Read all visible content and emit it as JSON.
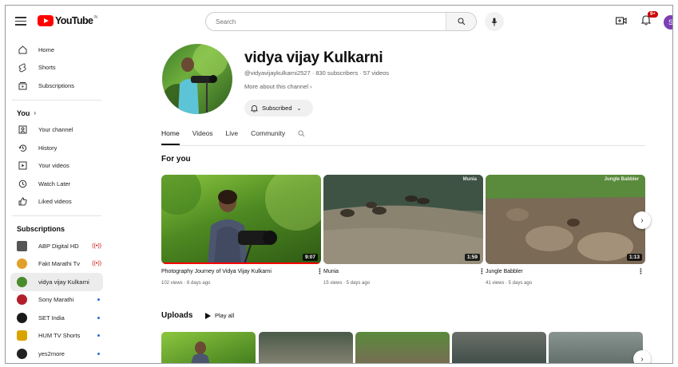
{
  "app": {
    "logo_text": "YouTube",
    "logo_suffix": "IN"
  },
  "search": {
    "placeholder": "Search"
  },
  "notifications": {
    "badge": "9+"
  },
  "account": {
    "initial": "S"
  },
  "sidebar": {
    "main": [
      {
        "label": "Home",
        "icon": "home-icon"
      },
      {
        "label": "Shorts",
        "icon": "shorts-icon"
      },
      {
        "label": "Subscriptions",
        "icon": "subscriptions-icon"
      }
    ],
    "you_title": "You",
    "you": [
      {
        "label": "Your channel",
        "icon": "channel-icon"
      },
      {
        "label": "History",
        "icon": "history-icon"
      },
      {
        "label": "Your videos",
        "icon": "your-videos-icon"
      },
      {
        "label": "Watch Later",
        "icon": "watch-later-icon"
      },
      {
        "label": "Liked videos",
        "icon": "like-icon"
      }
    ],
    "subscriptions_title": "Subscriptions",
    "subscriptions": [
      {
        "label": "ABP Digital HD",
        "color": "#555555",
        "status": "live"
      },
      {
        "label": "Fakt Marathi Tv",
        "color": "#e2a02a",
        "status": "live"
      },
      {
        "label": "vidya vijay Kulkarni",
        "color": "#4b8b2c",
        "status": "active"
      },
      {
        "label": "Sony Marathi",
        "color": "#b21f2a",
        "status": "dot"
      },
      {
        "label": "SET India",
        "color": "#1a1a1a",
        "status": "dot"
      },
      {
        "label": "HUM TV Shorts",
        "color": "#d9a400",
        "status": "dot"
      },
      {
        "label": "yes2more",
        "color": "#222222",
        "status": "dot"
      }
    ]
  },
  "channel": {
    "name": "vidya vijay Kulkarni",
    "meta": "@vidyavijaykulkarni2527 · 830 subscribers · 57 videos",
    "more": "More about this channel",
    "subscribe_label": "Subscribed",
    "tabs": [
      "Home",
      "Videos",
      "Live",
      "Community"
    ]
  },
  "for_you": {
    "title": "For you",
    "videos": [
      {
        "title": "Photography Journey of Vidya Vijay Kulkarni",
        "meta": "102 views · 6 days ago",
        "duration": "9:07",
        "overlay": ""
      },
      {
        "title": "Munia",
        "meta": "15 views · 5 days ago",
        "duration": "1:59",
        "overlay": "Munia"
      },
      {
        "title": "Jungle Babbler",
        "meta": "41 views · 5 days ago",
        "duration": "1:13",
        "overlay": "Jungle Babbler"
      }
    ]
  },
  "uploads": {
    "title": "Uploads",
    "play_all": "Play all"
  },
  "colors": {
    "brand_red": "#ff0000",
    "badge_red": "#cc0000",
    "avatar_purple": "#7b3fb5"
  }
}
